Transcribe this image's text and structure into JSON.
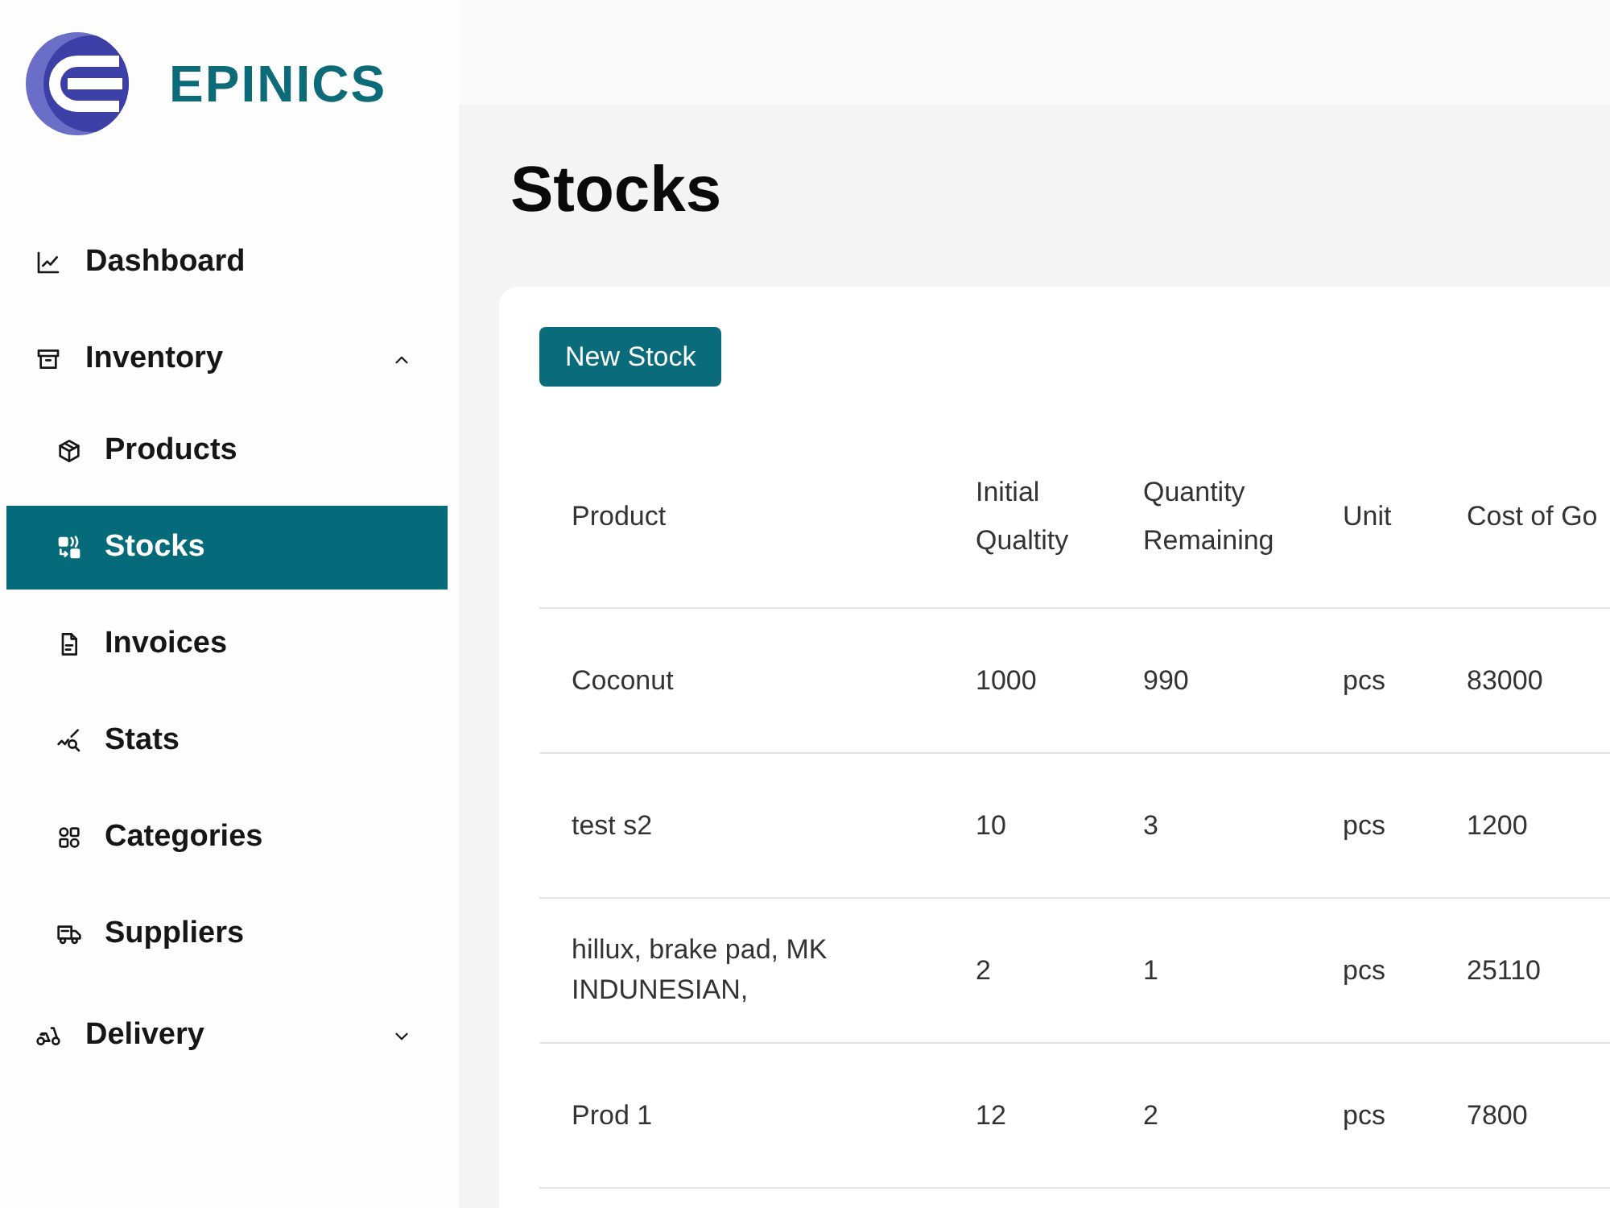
{
  "brand": {
    "name": "EPINICS"
  },
  "sidebar": {
    "items": [
      {
        "kind": "link",
        "label": "Dashboard",
        "selected": false
      },
      {
        "kind": "group",
        "label": "Inventory",
        "selected": false,
        "expanded": true,
        "children": [
          {
            "label": "Products",
            "selected": false
          },
          {
            "label": "Stocks",
            "selected": true
          },
          {
            "label": "Invoices",
            "selected": false
          },
          {
            "label": "Stats",
            "selected": false
          },
          {
            "label": "Categories",
            "selected": false
          },
          {
            "label": "Suppliers",
            "selected": false
          }
        ]
      },
      {
        "kind": "group",
        "label": "Delivery",
        "selected": false,
        "expanded": false
      }
    ]
  },
  "page": {
    "title": "Stocks",
    "primary_button": {
      "label": "New Stock"
    }
  },
  "table": {
    "columns": [
      "Product",
      "Initial Qualtity",
      "Quantity Remaining",
      "Unit",
      "Cost of Go"
    ],
    "rows": [
      [
        "Coconut",
        "1000",
        "990",
        "pcs",
        "83000"
      ],
      [
        "test s2",
        "10",
        "3",
        "pcs",
        "1200"
      ],
      [
        "hillux, brake pad, MK INDUNESIAN,",
        "2",
        "1",
        "pcs",
        "25110"
      ],
      [
        "Prod 1",
        "12",
        "2",
        "pcs",
        "7800"
      ]
    ]
  }
}
